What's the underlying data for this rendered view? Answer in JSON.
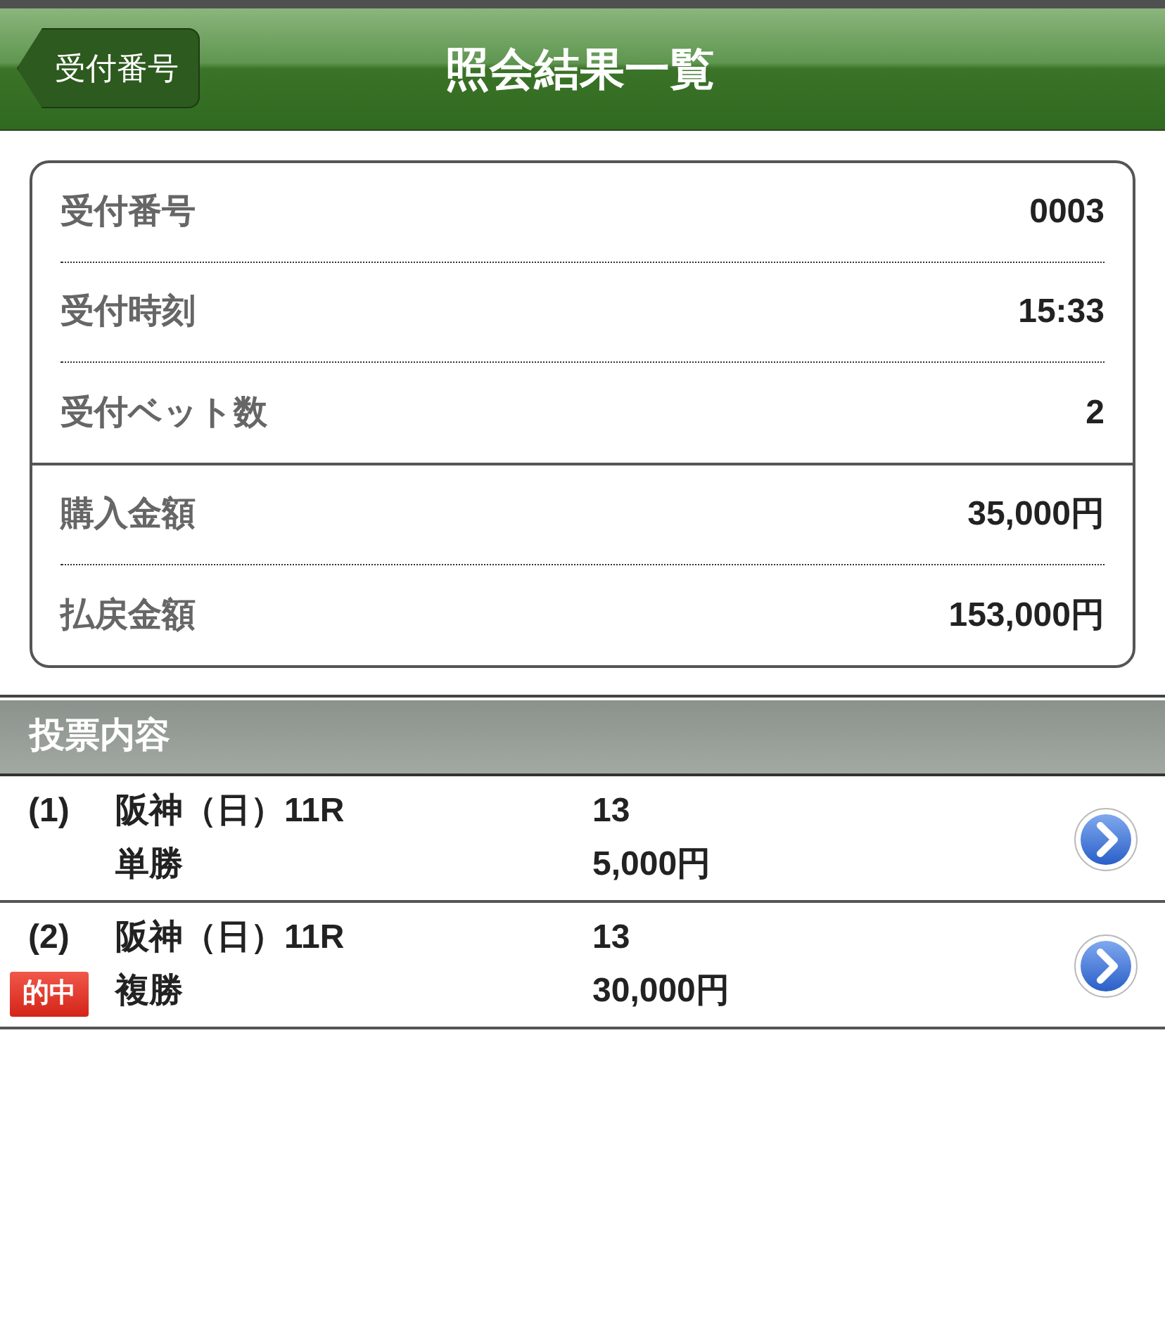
{
  "nav": {
    "back_button": "受付番号",
    "title": "照会結果一覧"
  },
  "summary": {
    "groups": [
      [
        {
          "label": "受付番号",
          "value": "0003"
        },
        {
          "label": "受付時刻",
          "value": "15:33"
        },
        {
          "label": "受付ベット数",
          "value": "2"
        }
      ],
      [
        {
          "label": "購入金額",
          "value": "35,000円"
        },
        {
          "label": "払戻金額",
          "value": "153,000円"
        }
      ]
    ]
  },
  "section_header": "投票内容",
  "bets": [
    {
      "number": "(1)",
      "race": "阪神（日）11R",
      "bet_type": "単勝",
      "selection": "13",
      "amount": "5,000円"
    },
    {
      "number": "(2)",
      "badge": "的中",
      "race": "阪神（日）11R",
      "bet_type": "複勝",
      "selection": "13",
      "amount": "30,000円"
    }
  ]
}
